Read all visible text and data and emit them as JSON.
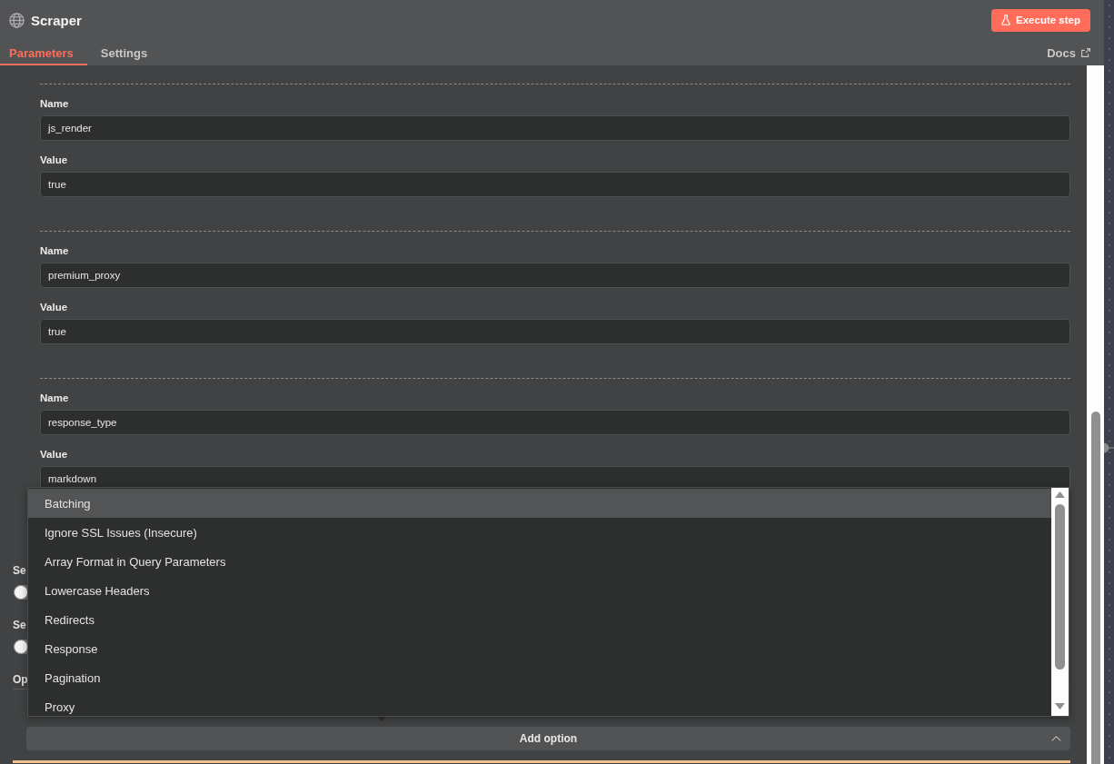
{
  "header": {
    "title": "Scraper",
    "execute_button": "Execute step"
  },
  "tabs": [
    {
      "label": "Parameters",
      "selected": true
    },
    {
      "label": "Settings",
      "selected": false
    }
  ],
  "docs_link": "Docs",
  "parameters": [
    {
      "name_label": "Name",
      "name": "js_render",
      "value_label": "Value",
      "value": "true"
    },
    {
      "name_label": "Name",
      "name": "premium_proxy",
      "value_label": "Value",
      "value": "true"
    },
    {
      "name_label": "Name",
      "name": "response_type",
      "value_label": "Value",
      "value": "markdown"
    }
  ],
  "settings": [
    {
      "kind": "toggle",
      "label": "Se",
      "on": false
    },
    {
      "kind": "toggle",
      "label": "Se",
      "on": false
    },
    {
      "kind": "section",
      "label": "Op"
    }
  ],
  "options_menu": {
    "items": [
      {
        "label": "Batching",
        "highlighted": true
      },
      {
        "label": "Ignore SSL Issues (Insecure)",
        "highlighted": false
      },
      {
        "label": "Array Format in Query Parameters",
        "highlighted": false
      },
      {
        "label": "Lowercase Headers",
        "highlighted": false
      },
      {
        "label": "Redirects",
        "highlighted": false
      },
      {
        "label": "Response",
        "highlighted": false
      },
      {
        "label": "Pagination",
        "highlighted": false
      },
      {
        "label": "Proxy",
        "highlighted": false
      }
    ]
  },
  "add_option_button": "Add option"
}
